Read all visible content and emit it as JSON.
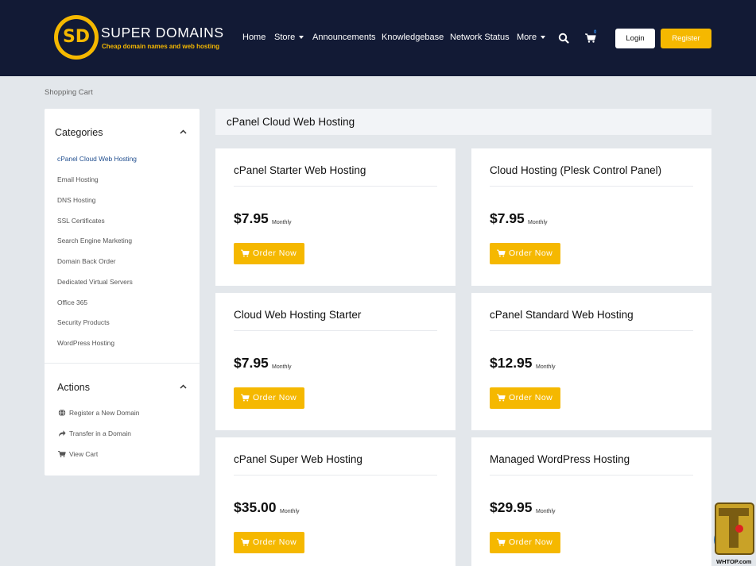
{
  "brand": {
    "logo_letters": "SD",
    "name": "SUPER DOMAINS",
    "tagline": "Cheap domain names and web hosting",
    "accent_color": "#f5b800",
    "header_color": "#121a35"
  },
  "nav": {
    "items": [
      "Home",
      "Store",
      "Announcements",
      "Knowledgebase",
      "Network Status",
      "More"
    ],
    "cart_count": "0",
    "login": "Login",
    "register": "Register"
  },
  "breadcrumb": "Shopping Cart",
  "sidebar": {
    "categories_title": "Categories",
    "categories": [
      "cPanel Cloud Web Hosting",
      "Email Hosting",
      "DNS Hosting",
      "SSL Certificates",
      "Search Engine Marketing",
      "Domain Back Order",
      "Dedicated Virtual Servers",
      "Office 365",
      "Security Products",
      "WordPress Hosting"
    ],
    "actions_title": "Actions",
    "actions": [
      "Register a New Domain",
      "Transfer in a Domain",
      "View Cart"
    ]
  },
  "main": {
    "title": "cPanel Cloud Web Hosting",
    "products": [
      {
        "name": "cPanel Starter Web Hosting",
        "price": "$7.95",
        "period": "Monthly",
        "button": "Order Now"
      },
      {
        "name": "Cloud Hosting (Plesk Control Panel)",
        "price": "$7.95",
        "period": "Monthly",
        "button": "Order Now"
      },
      {
        "name": "Cloud Web Hosting Starter",
        "price": "$7.95",
        "period": "Monthly",
        "button": "Order Now"
      },
      {
        "name": "cPanel Standard Web Hosting",
        "price": "$12.95",
        "period": "Monthly",
        "button": "Order Now"
      },
      {
        "name": "cPanel Super Web Hosting",
        "price": "$35.00",
        "period": "Monthly",
        "button": "Order Now"
      },
      {
        "name": "Managed WordPress Hosting",
        "price": "$29.95",
        "period": "Monthly",
        "button": "Order Now"
      }
    ]
  },
  "watermark": "WHTOP.com"
}
